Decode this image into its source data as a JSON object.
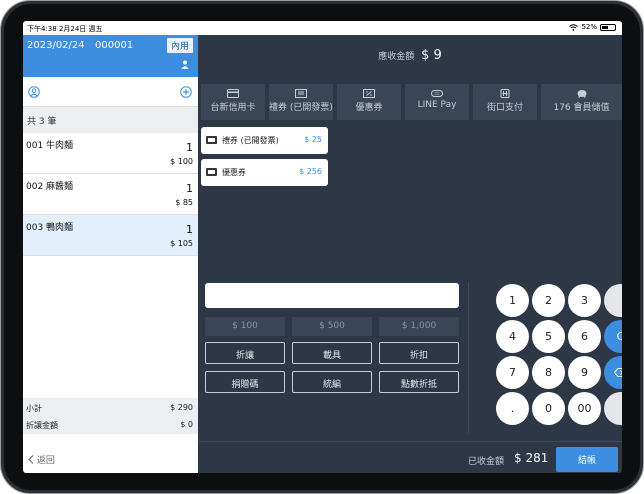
{
  "status": {
    "time_date": "下午4:38   2月24日 週五",
    "battery": "52%"
  },
  "order": {
    "date": "2023/02/24",
    "number": "000001",
    "type": "內用"
  },
  "items_count": "共 3 筆",
  "items": [
    {
      "name": "001 牛肉麵",
      "qty": "1",
      "price": "$ 100"
    },
    {
      "name": "002 麻醬麵",
      "qty": "1",
      "price": "$ 85"
    },
    {
      "name": "003 鴨肉麵",
      "qty": "1",
      "price": "$ 105"
    }
  ],
  "summary": {
    "subtotal_label": "小計",
    "subtotal": "$ 290",
    "discount_label": "折讓金額",
    "discount": "$ 0"
  },
  "back_label": "返回",
  "due": {
    "label": "應收金額",
    "amount": "$ 9"
  },
  "methods": [
    "台新信用卡",
    "禮券 (已開發票)",
    "優惠券",
    "LINE Pay",
    "街口支付",
    "176 會員儲值"
  ],
  "vouchers": [
    {
      "name": "禮券 (已開發票)",
      "value": "$ 25"
    },
    {
      "name": "優惠券",
      "value": "$ 256"
    }
  ],
  "quick_amounts": [
    "$ 100",
    "$ 500",
    "$ 1,000"
  ],
  "options": [
    "折讓",
    "載具",
    "折扣",
    "捐贈碼",
    "統編",
    "點數折抵"
  ],
  "keypad": [
    "1",
    "2",
    "3",
    "",
    "4",
    "5",
    "6",
    "C",
    "7",
    "8",
    "9",
    "⌫",
    ".",
    "0",
    "00",
    ""
  ],
  "footer": {
    "received_label": "已收金額",
    "received": "$ 281",
    "checkout": "結帳"
  },
  "colors": {
    "accent": "#3d8ee0",
    "panel": "#2d3745",
    "tile": "#3a4556"
  }
}
